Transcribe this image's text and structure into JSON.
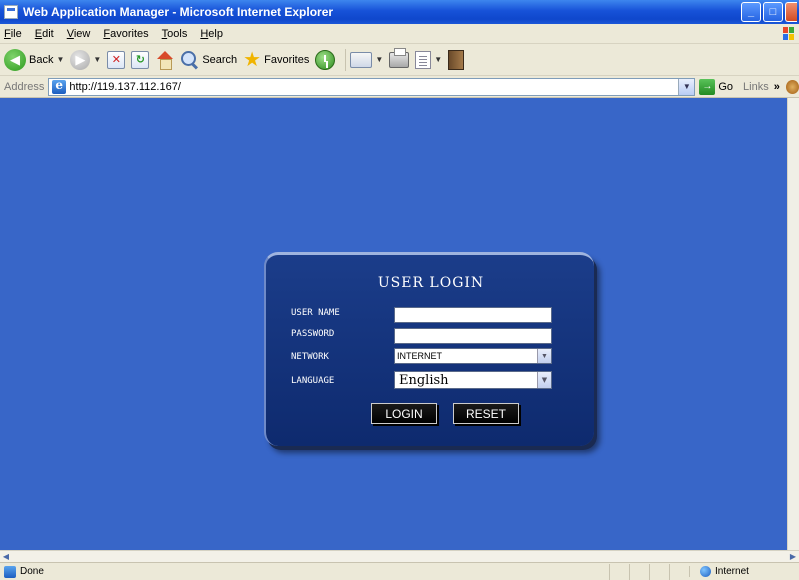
{
  "window": {
    "title": "Web Application Manager - Microsoft Internet Explorer",
    "buttons": {
      "minimize": "_",
      "maximize": "□"
    }
  },
  "menu": {
    "items": [
      "File",
      "Edit",
      "View",
      "Favorites",
      "Tools",
      "Help"
    ]
  },
  "toolbar": {
    "back_label": "Back",
    "search_label": "Search",
    "favorites_label": "Favorites"
  },
  "address_bar": {
    "label": "Address",
    "url": "http://119.137.112.167/",
    "go_label": "Go",
    "links_label": "Links",
    "links_chevron": "»"
  },
  "login": {
    "title": "USER LOGIN",
    "username_label": "USER NAME",
    "password_label": "PASSWORD",
    "network_label": "NETWORK",
    "language_label": "LANGUAGE",
    "username_value": "",
    "password_value": "",
    "network_value": "INTERNET",
    "language_value": "English",
    "login_button": "LOGIN",
    "reset_button": "RESET"
  },
  "status": {
    "text": "Done",
    "zone": "Internet"
  },
  "colors": {
    "page_background": "#3866c8",
    "panel_background": "#0e2a6e",
    "titlebar": "#0f47cc"
  },
  "icons": {
    "back": "back-arrow-icon",
    "forward": "forward-arrow-icon",
    "stop": "stop-icon",
    "refresh": "refresh-icon",
    "home": "home-icon",
    "search": "search-icon",
    "favorites": "star-icon",
    "history": "history-icon",
    "mail": "mail-icon",
    "print": "print-icon",
    "edit": "edit-icon",
    "research": "research-icon"
  }
}
